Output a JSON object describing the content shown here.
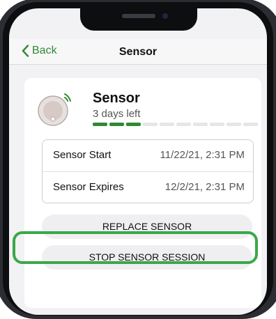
{
  "nav": {
    "back_label": "Back",
    "title": "Sensor"
  },
  "sensor": {
    "name": "Sensor",
    "days_left": "3 days left",
    "progress": {
      "filled_segments": 3,
      "total_segments": 10
    }
  },
  "info": {
    "rows": [
      {
        "label": "Sensor Start",
        "value": "11/22/21, 2:31 PM"
      },
      {
        "label": "Sensor Expires",
        "value": "12/2/21, 2:31 PM"
      }
    ]
  },
  "actions": {
    "replace_label": "REPLACE SENSOR",
    "stop_label": "STOP SENSOR SESSION"
  },
  "colors": {
    "accent": "#2f8a34",
    "highlight": "#3aa84a"
  },
  "icons": [
    "back-chevron-icon",
    "sensor-icon",
    "signal-icon"
  ]
}
